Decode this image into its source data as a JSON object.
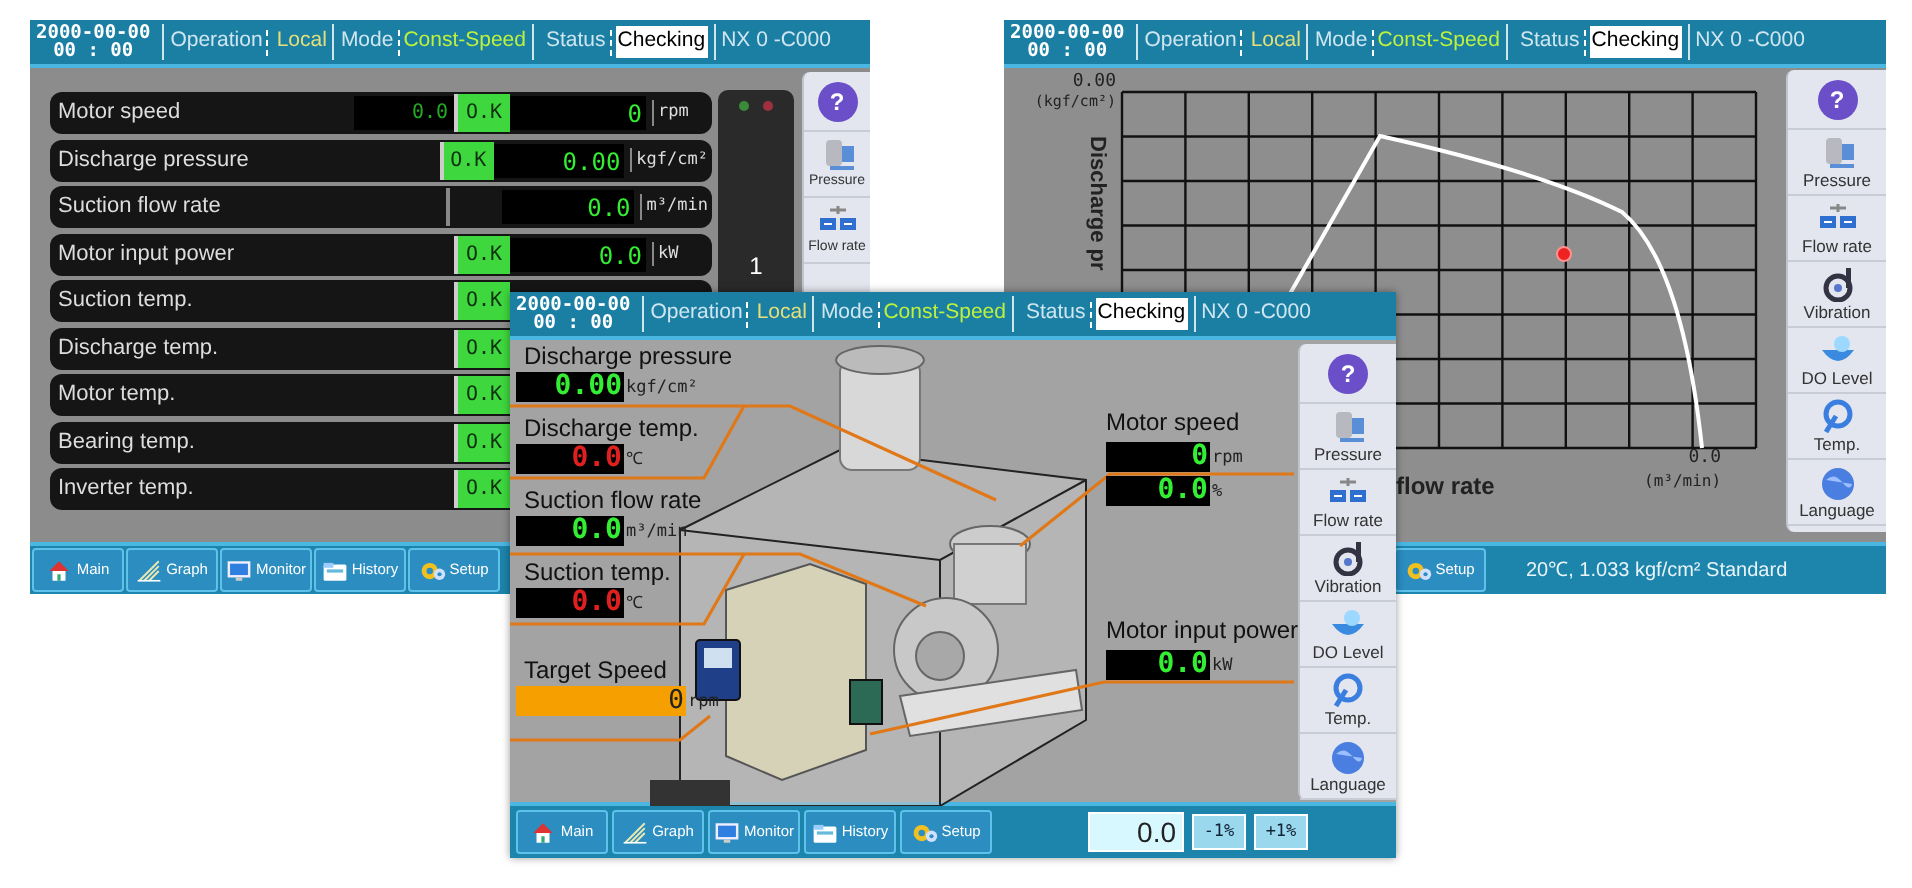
{
  "monitor_screen": {
    "header": {
      "date": "2000-00-00",
      "time": "00 : 00",
      "operation_label": "Operation",
      "operation": "Local",
      "mode_label": "Mode",
      "mode": "Const-Speed",
      "status_label": "Status",
      "status": "Checking",
      "code": "NX 0 -C000"
    },
    "rows": [
      {
        "label": "Motor speed",
        "reading": "0.0",
        "status": "O.K",
        "value": "0",
        "unit": "rpm"
      },
      {
        "label": "Discharge pressure",
        "status": "O.K",
        "value": "0.00",
        "unit": "kgf/cm²"
      },
      {
        "label": "Suction flow rate",
        "value": "0.0",
        "unit": "m³/min"
      },
      {
        "label": "Motor input power",
        "status": "O.K",
        "value": "0.0",
        "unit": "kW"
      },
      {
        "label": "Suction temp.",
        "status": "O.K"
      },
      {
        "label": "Discharge temp.",
        "status": "O.K"
      },
      {
        "label": "Motor temp.",
        "status": "O.K"
      },
      {
        "label": "Bearing temp.",
        "status": "O.K"
      },
      {
        "label": "Inverter temp.",
        "status": "O.K"
      }
    ],
    "alarm_panel": {
      "count": "1"
    },
    "sidebar": {
      "help": "?",
      "items": [
        {
          "kind": "pressure",
          "label": "Pressure"
        },
        {
          "kind": "flow",
          "label": "Flow rate"
        }
      ]
    },
    "nav": [
      {
        "kind": "home",
        "label": "Main"
      },
      {
        "kind": "graph",
        "label": "Graph"
      },
      {
        "kind": "monitor",
        "label": "Monitor"
      },
      {
        "kind": "history",
        "label": "History"
      },
      {
        "kind": "setup",
        "label": "Setup"
      }
    ]
  },
  "graph_screen": {
    "header": {
      "date": "2000-00-00",
      "time": "00 : 00",
      "operation_label": "Operation",
      "operation": "Local",
      "mode_label": "Mode",
      "mode": "Const-Speed",
      "status_label": "Status",
      "status": "Checking",
      "code": "NX 0 -C000"
    },
    "chart": {
      "y_value": "0.00",
      "y_unit": "(kgf/cm²)",
      "y_title": "Discharge pr",
      "x_title": "flow rate",
      "x_value": "0.0",
      "x_unit": "(m³/min)"
    },
    "sidebar": {
      "help": "?",
      "items": [
        {
          "kind": "pressure",
          "label": "Pressure"
        },
        {
          "kind": "flow",
          "label": "Flow rate"
        },
        {
          "kind": "vibration",
          "label": "Vibration"
        },
        {
          "kind": "level",
          "label": "DO Level"
        },
        {
          "kind": "temp",
          "label": "Temp."
        },
        {
          "kind": "language",
          "label": "Language"
        }
      ]
    },
    "nav": [
      {
        "kind": "setup",
        "label": "Setup"
      }
    ],
    "condition": "20℃, 1.033 kgf/cm² Standard"
  },
  "main_screen": {
    "header": {
      "date": "2000-00-00",
      "time": "00 : 00",
      "operation_label": "Operation",
      "operation": "Local",
      "mode_label": "Mode",
      "mode": "Const-Speed",
      "status_label": "Status",
      "status": "Checking",
      "code": "NX 0 -C000"
    },
    "left_readings": [
      {
        "label": "Discharge pressure",
        "value": "0.00",
        "unit": "kgf/cm²",
        "kind": "normal"
      },
      {
        "label": "Discharge temp.",
        "value": "0.0",
        "unit": "℃",
        "kind": "alarm"
      },
      {
        "label": "Suction flow rate",
        "value": "0.0",
        "unit": "m³/min",
        "kind": "normal"
      },
      {
        "label": "Suction temp.",
        "value": "0.0",
        "unit": "℃",
        "kind": "alarm"
      }
    ],
    "target_speed": {
      "label": "Target Speed",
      "value": "0",
      "unit": "rpm"
    },
    "right_readings": [
      {
        "label": "Motor speed",
        "values": [
          {
            "value": "0",
            "unit": "rpm",
            "kind": "normal"
          },
          {
            "value": "0.0",
            "unit": "%",
            "kind": "normal"
          }
        ]
      },
      {
        "label": "Motor input power",
        "values": [
          {
            "value": "0.0",
            "unit": "kW",
            "kind": "normal"
          }
        ]
      }
    ],
    "sidebar": {
      "help": "?",
      "items": [
        {
          "kind": "pressure",
          "label": "Pressure"
        },
        {
          "kind": "flow",
          "label": "Flow rate"
        },
        {
          "kind": "vibration",
          "label": "Vibration"
        },
        {
          "kind": "level",
          "label": "DO Level"
        },
        {
          "kind": "temp",
          "label": "Temp."
        },
        {
          "kind": "language",
          "label": "Language"
        }
      ]
    },
    "nav": [
      {
        "kind": "home",
        "label": "Main"
      },
      {
        "kind": "graph",
        "label": "Graph"
      },
      {
        "kind": "monitor",
        "label": "Monitor"
      },
      {
        "kind": "history",
        "label": "History"
      },
      {
        "kind": "setup",
        "label": "Setup"
      }
    ],
    "adjust": {
      "value": "0.0",
      "buttons": [
        "-1%",
        "+1%"
      ]
    }
  }
}
